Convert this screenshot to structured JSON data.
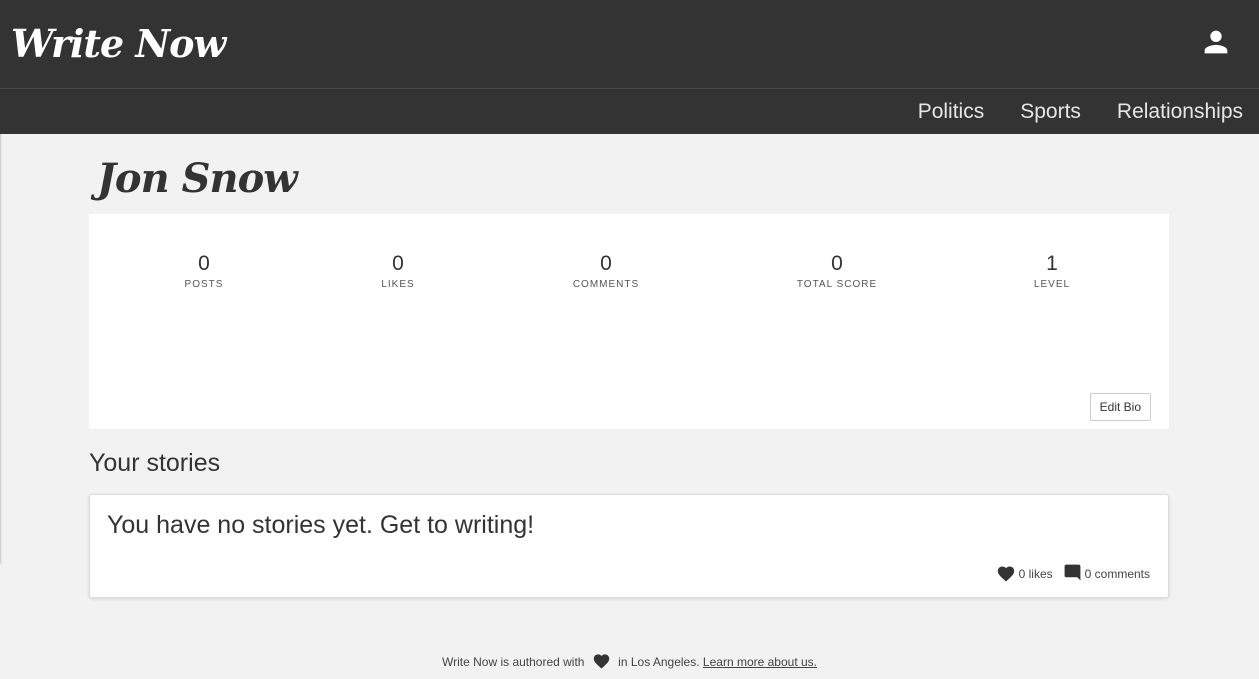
{
  "header": {
    "logo": "Write Now",
    "user_icon": "person-icon"
  },
  "nav": {
    "items": [
      "Politics",
      "Sports",
      "Relationships"
    ]
  },
  "profile": {
    "name": "Jon Snow",
    "stats": [
      {
        "value": "0",
        "label": "POSTS"
      },
      {
        "value": "0",
        "label": "LIKES"
      },
      {
        "value": "0",
        "label": "COMMENTS"
      },
      {
        "value": "0",
        "label": "TOTAL SCORE"
      },
      {
        "value": "1",
        "label": "LEVEL"
      }
    ],
    "edit_bio_label": "Edit Bio"
  },
  "stories": {
    "heading": "Your stories",
    "empty_message": "You have no stories yet. Get to writing!",
    "likes": "0 likes",
    "comments": "0 comments"
  },
  "footer": {
    "text_before": "Write Now is authored with",
    "text_after": "in Los Angeles.",
    "link": "Learn more about us."
  },
  "colors": {
    "header_bg": "#333333",
    "page_bg": "#f2f2f2",
    "card_bg": "#ffffff"
  }
}
